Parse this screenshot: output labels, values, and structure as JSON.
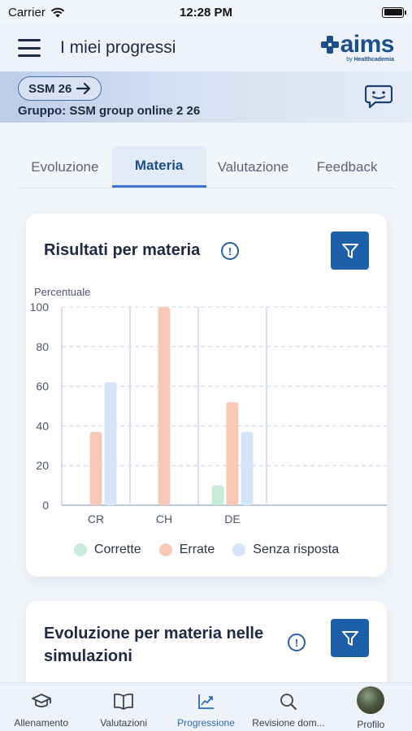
{
  "status_bar": {
    "carrier": "Carrier",
    "time": "12:28 PM"
  },
  "header": {
    "title": "I miei progressi",
    "logo_text": "aims",
    "logo_sub_by": "by",
    "logo_sub_brand": "Healthcademia"
  },
  "banner": {
    "pill_label": "SSM 26",
    "group": "Gruppo: SSM group online 2 26"
  },
  "tabs": [
    {
      "label": "Evoluzione",
      "active": false
    },
    {
      "label": "Materia",
      "active": true
    },
    {
      "label": "Valutazione",
      "active": false
    },
    {
      "label": "Feedback",
      "active": false
    }
  ],
  "card1": {
    "title": "Risultati per materia",
    "info": "!"
  },
  "card2": {
    "title_line1": "Evoluzione per materia nelle",
    "title_line2": "simulazioni",
    "info": "!"
  },
  "chart_data": {
    "type": "bar",
    "ylabel": "Percentuale",
    "categories": [
      "CR",
      "CH",
      "DE"
    ],
    "ylim": [
      0,
      100
    ],
    "yticks": [
      0,
      20,
      40,
      60,
      80,
      100
    ],
    "series": [
      {
        "name": "Corrette",
        "values": [
          0,
          0,
          10
        ],
        "color": "#c8ecd9"
      },
      {
        "name": "Errate",
        "values": [
          37,
          100,
          52
        ],
        "color": "#f9c9b8"
      },
      {
        "name": "Senza risposta",
        "values": [
          62,
          0,
          37
        ],
        "color": "#d6e4fa"
      }
    ],
    "grid": true,
    "legend_position": "bottom"
  },
  "bottom_nav": [
    {
      "label": "Allenamento",
      "icon": "graduation-cap-icon"
    },
    {
      "label": "Valutazioni",
      "icon": "book-icon"
    },
    {
      "label": "Progressione",
      "icon": "chart-icon",
      "active": true
    },
    {
      "label": "Revisione dom...",
      "icon": "search-icon"
    },
    {
      "label": "Profilo",
      "icon": "avatar"
    }
  ]
}
